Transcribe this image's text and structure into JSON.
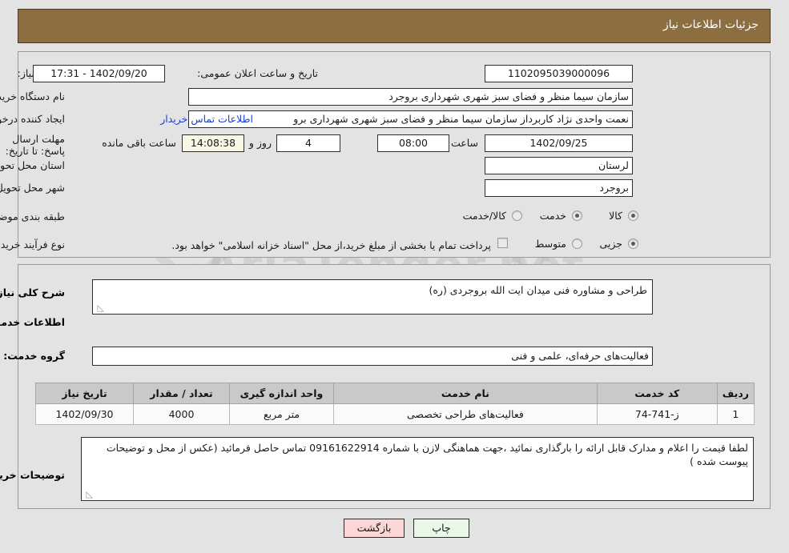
{
  "header": {
    "title": "جزئیات اطلاعات نیاز"
  },
  "watermark": {
    "text": "AriaTender.net"
  },
  "top_form": {
    "need_number": {
      "label": "شماره نیاز:",
      "value": "1102095039000096"
    },
    "announce_datetime": {
      "label": "تاریخ و ساعت اعلان عمومی:",
      "value": "1402/09/20 - 17:31"
    },
    "buyer_org": {
      "label": "نام دستگاه خریدار:",
      "value": "سازمان سیما منظر و فضای سبز شهری شهرداری بروجرد"
    },
    "requester": {
      "label": "ایجاد کننده درخواست:",
      "value": "نعمت واحدی نژاد کاربرداز سازمان سیما منظر و فضای سبز شهری شهرداری برو"
    },
    "buyer_contact_link": "اطلاعات تماس خریدار",
    "deadline": {
      "label": "مهلت ارسال پاسخ: تا تاریخ:",
      "date": "1402/09/25",
      "hour_label": "ساعت",
      "hour": "08:00",
      "days": "4",
      "days_label": "روز و",
      "countdown": "14:08:38",
      "remaining_label": "ساعت باقی مانده"
    },
    "province": {
      "label": "استان محل تحویل:",
      "value": "لرستان"
    },
    "city": {
      "label": "شهر محل تحویل:",
      "value": "بروجرد"
    },
    "category": {
      "label": "طبقه بندی موضوعی:",
      "options": [
        "کالا",
        "خدمت",
        "کالا/خدمت"
      ],
      "selected": "خدمت"
    },
    "purchase_type": {
      "label": "نوع فرآیند خرید :",
      "options": [
        "جزیی",
        "متوسط"
      ],
      "selected": ""
    },
    "treasury_note": "پرداخت تمام یا بخشی از مبلغ خرید،از محل \"اسناد خزانه اسلامی\" خواهد بود.",
    "treasury_checked": false
  },
  "mid_form": {
    "need_description": {
      "label": "شرح کلی نیاز:",
      "value": "طراحی و مشاوره فنی میدان ایت الله بروجردی (ره)"
    },
    "services_section_title": "اطلاعات خدمات مورد نیاز",
    "service_group": {
      "label": "گروه خدمت:",
      "value": "فعالیت‌های حرفه‌ای، علمی و فنی"
    },
    "buyer_notes": {
      "label": "توضیحات خریدار:",
      "value": "لطفا قیمت را اعلام و مدارک قابل ارائه را بارگذاری نمائید ،جهت هماهنگی لازن با شماره 09161622914 تماس حاصل فرمائید (عکس از محل و توضیحات پیوست شده )"
    }
  },
  "table": {
    "headers": [
      "ردیف",
      "کد خدمت",
      "نام خدمت",
      "واحد اندازه گیری",
      "تعداد / مقدار",
      "تاریخ نیاز"
    ],
    "rows": [
      {
        "row": "1",
        "code": "ز-741-74",
        "name": "فعالیت‌های طراحی تخصصی",
        "unit": "متر مربع",
        "quantity": "4000",
        "need_date": "1402/09/30"
      }
    ]
  },
  "footer": {
    "print_label": "چاپ",
    "back_label": "بازگشت"
  },
  "colors": {
    "header_bg": "#8d6e41",
    "page_bg": "#e3e3e3",
    "link": "#1b3fd2",
    "table_header_bg": "#c9c9c9",
    "print_btn_bg": "#e9f7e9",
    "back_btn_bg": "#fbd6d6",
    "countdown_bg": "#f7f7e4"
  }
}
